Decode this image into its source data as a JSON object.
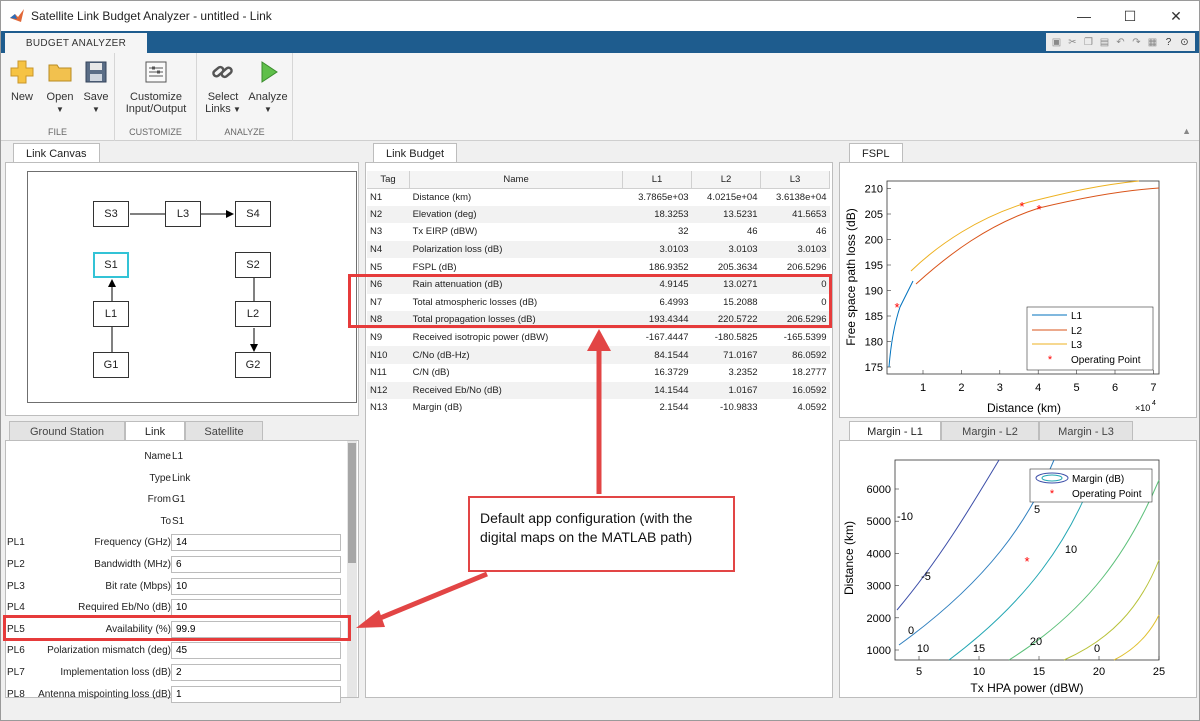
{
  "window": {
    "title": "Satellite Link Budget Analyzer - untitled - Link",
    "minimize": "—",
    "maximize": "☐",
    "close": "✕"
  },
  "toolstrip": {
    "tab": "BUDGET ANALYZER",
    "groups": {
      "file": "FILE",
      "customize": "CUSTOMIZE",
      "analyze": "ANALYZE"
    },
    "buttons": {
      "new": "New",
      "open": "Open",
      "save": "Save",
      "customize_line1": "Customize",
      "customize_line2": "Input/Output",
      "select_line1": "Select",
      "select_line2": "Links",
      "analyze": "Analyze"
    }
  },
  "link_canvas": {
    "tab": "Link Canvas",
    "nodes": [
      "S3",
      "L3",
      "S4",
      "S1",
      "S2",
      "L1",
      "L2",
      "G1",
      "G2"
    ]
  },
  "properties": {
    "tabs": [
      "Ground Station",
      "Link",
      "Satellite"
    ],
    "static_rows": [
      {
        "label": "Name",
        "value": "L1"
      },
      {
        "label": "Type",
        "value": "Link"
      },
      {
        "label": "From",
        "value": "G1"
      },
      {
        "label": "To",
        "value": "S1"
      }
    ],
    "input_rows": [
      {
        "tag": "PL1",
        "label": "Frequency (GHz)",
        "value": "14"
      },
      {
        "tag": "PL2",
        "label": "Bandwidth (MHz)",
        "value": "6"
      },
      {
        "tag": "PL3",
        "label": "Bit rate (Mbps)",
        "value": "10"
      },
      {
        "tag": "PL4",
        "label": "Required Eb/No (dB)",
        "value": "10"
      },
      {
        "tag": "PL5",
        "label": "Availability (%)",
        "value": "99.9"
      },
      {
        "tag": "PL6",
        "label": "Polarization mismatch (deg)",
        "value": "45"
      },
      {
        "tag": "PL7",
        "label": "Implementation loss (dB)",
        "value": "2"
      },
      {
        "tag": "PL8",
        "label": "Antenna mispointing loss (dB)",
        "value": "1"
      }
    ]
  },
  "link_budget": {
    "tab": "Link Budget",
    "columns": [
      "Tag",
      "Name",
      "L1",
      "L2",
      "L3"
    ],
    "rows": [
      [
        "N1",
        "Distance (km)",
        "3.7865e+03",
        "4.0215e+04",
        "3.6138e+04"
      ],
      [
        "N2",
        "Elevation (deg)",
        "18.3253",
        "13.5231",
        "41.5653"
      ],
      [
        "N3",
        "Tx EIRP (dBW)",
        "32",
        "46",
        "46"
      ],
      [
        "N4",
        "Polarization loss (dB)",
        "3.0103",
        "3.0103",
        "3.0103"
      ],
      [
        "N5",
        "FSPL (dB)",
        "186.9352",
        "205.3634",
        "206.5296"
      ],
      [
        "N6",
        "Rain attenuation (dB)",
        "4.9145",
        "13.0271",
        "0"
      ],
      [
        "N7",
        "Total atmospheric losses (dB)",
        "6.4993",
        "15.2088",
        "0"
      ],
      [
        "N8",
        "Total propagation losses (dB)",
        "193.4344",
        "220.5722",
        "206.5296"
      ],
      [
        "N9",
        "Received isotropic power (dBW)",
        "-167.4447",
        "-180.5825",
        "-165.5399"
      ],
      [
        "N10",
        "C/No (dB-Hz)",
        "84.1544",
        "71.0167",
        "86.0592"
      ],
      [
        "N11",
        "C/N (dB)",
        "16.3729",
        "3.2352",
        "18.2777"
      ],
      [
        "N12",
        "Received Eb/No (dB)",
        "14.1544",
        "1.0167",
        "16.0592"
      ],
      [
        "N13",
        "Margin (dB)",
        "2.1544",
        "-10.9833",
        "4.0592"
      ]
    ]
  },
  "fspl_plot": {
    "tab": "FSPL",
    "xlabel": "Distance (km)",
    "ylabel": "Free space path loss (dB)",
    "x_exponent": "×10",
    "x_exponent_power": "4",
    "xticks": [
      "1",
      "2",
      "3",
      "4",
      "5",
      "6",
      "7"
    ],
    "yticks": [
      "175",
      "180",
      "185",
      "190",
      "195",
      "200",
      "205",
      "210"
    ],
    "legend": [
      "L1",
      "L2",
      "L3",
      "Operating Point"
    ],
    "colors": {
      "L1": "#0072bd",
      "L2": "#d95319",
      "L3": "#edb120",
      "op": "#ff0000"
    }
  },
  "margin_plot": {
    "tabs": [
      "Margin - L1",
      "Margin - L2",
      "Margin - L3"
    ],
    "xlabel": "Tx HPA power (dBW)",
    "ylabel": "Distance (km)",
    "xticks": [
      "5",
      "10",
      "15",
      "20",
      "25"
    ],
    "yticks": [
      "1000",
      "2000",
      "3000",
      "4000",
      "5000",
      "6000"
    ],
    "legend": [
      "Margin (dB)",
      "Operating Point"
    ],
    "contour_labels": [
      "-10",
      "-5",
      "0",
      "5",
      "10",
      "15",
      "20",
      "0",
      "5",
      "10"
    ]
  },
  "annotation": {
    "callout": "Default app configuration (with the digital maps on the MATLAB path)"
  }
}
